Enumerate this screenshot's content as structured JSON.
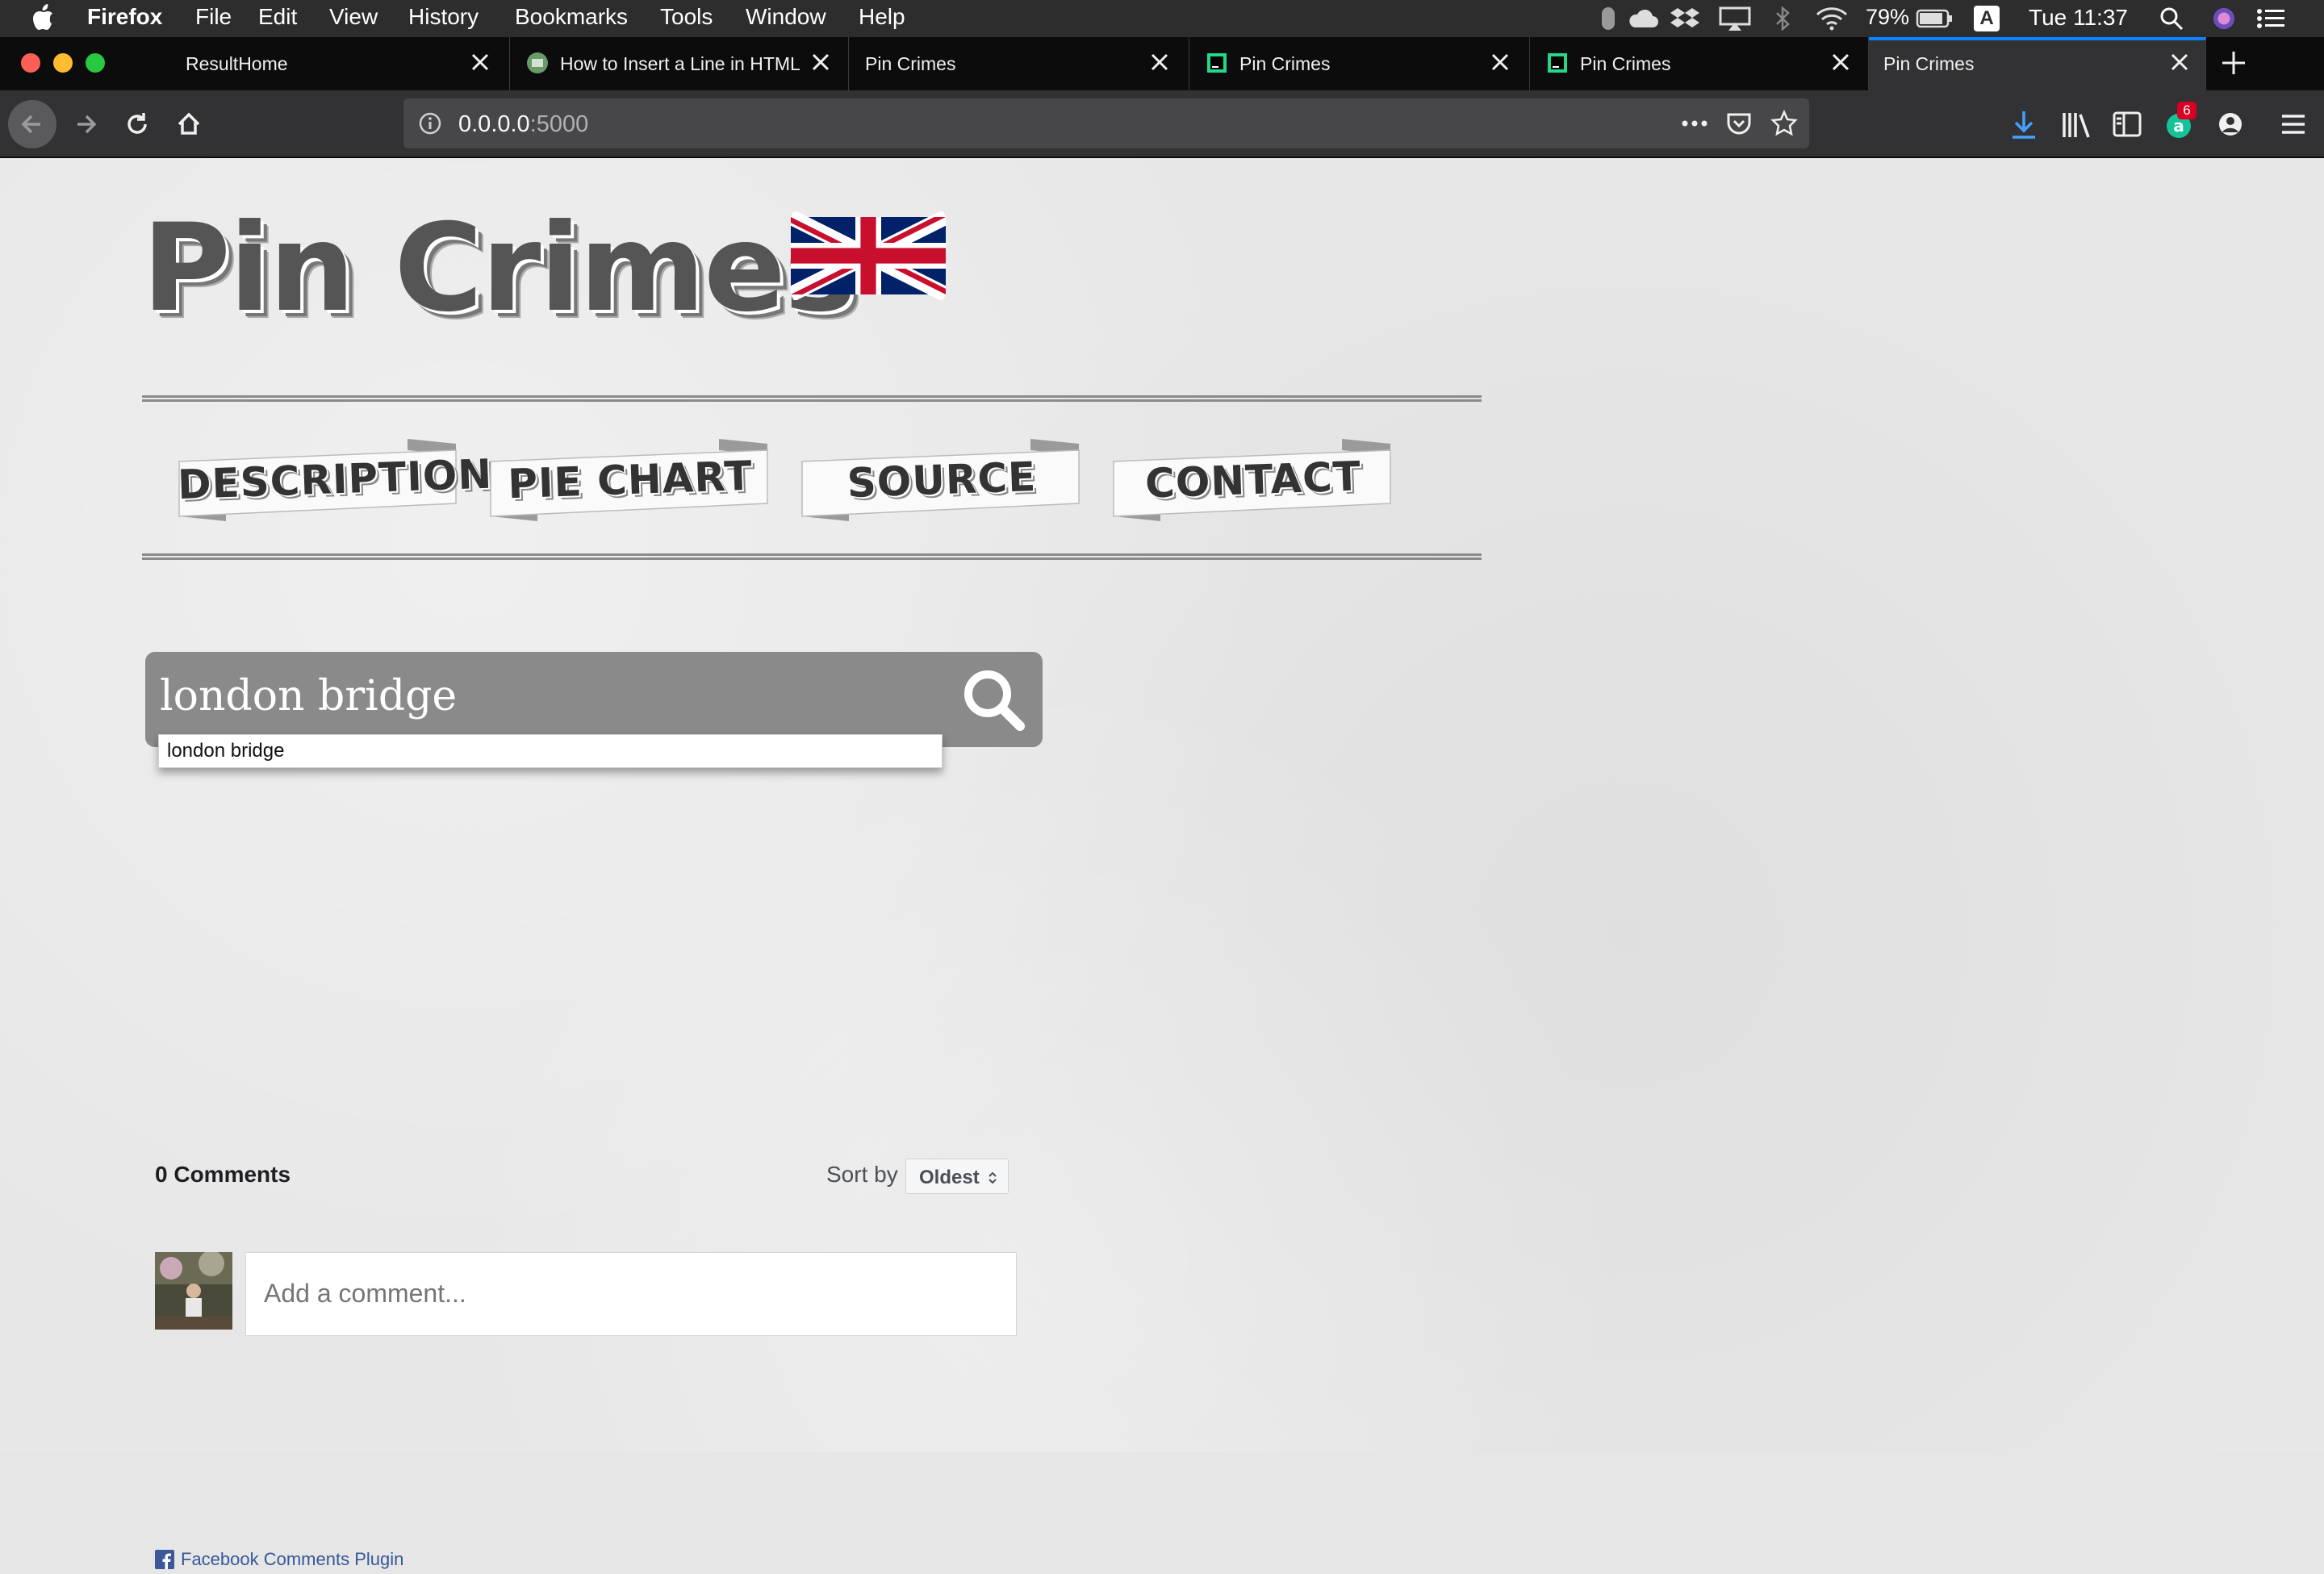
{
  "menubar": {
    "app": "Firefox",
    "items": [
      "File",
      "Edit",
      "View",
      "History",
      "Bookmarks",
      "Tools",
      "Window",
      "Help"
    ],
    "battery": "79%",
    "input_indicator": "A",
    "clock": "Tue 11:37"
  },
  "tabs": [
    {
      "title": "ResultHome",
      "favicon": "none-icon"
    },
    {
      "title": "How to Insert a Line in HTML",
      "favicon": "site-icon"
    },
    {
      "title": "Pin Crimes",
      "favicon": "none-icon"
    },
    {
      "title": "Pin Crimes",
      "favicon": "pycharm-icon"
    },
    {
      "title": "Pin Crimes",
      "favicon": "pycharm-icon"
    },
    {
      "title": "Pin Crimes",
      "favicon": "none-icon",
      "active": true
    }
  ],
  "toolbar": {
    "url_host": "0.0.0.0",
    "url_port": ":5000",
    "notification_badge": "6",
    "accent": "#0a84ff"
  },
  "site": {
    "logo_text": "Pin Crimes",
    "nav": [
      "DESCRIPTION",
      "PIE CHART",
      "SOURCE",
      "CONTACT"
    ]
  },
  "search": {
    "value": "london bridge",
    "suggestion": "london bridge"
  },
  "comments": {
    "count_label": "0 Comments",
    "sort_label": "Sort by",
    "sort_value": "Oldest",
    "placeholder": "Add a comment...",
    "plugin_label": "Facebook Comments Plugin"
  }
}
